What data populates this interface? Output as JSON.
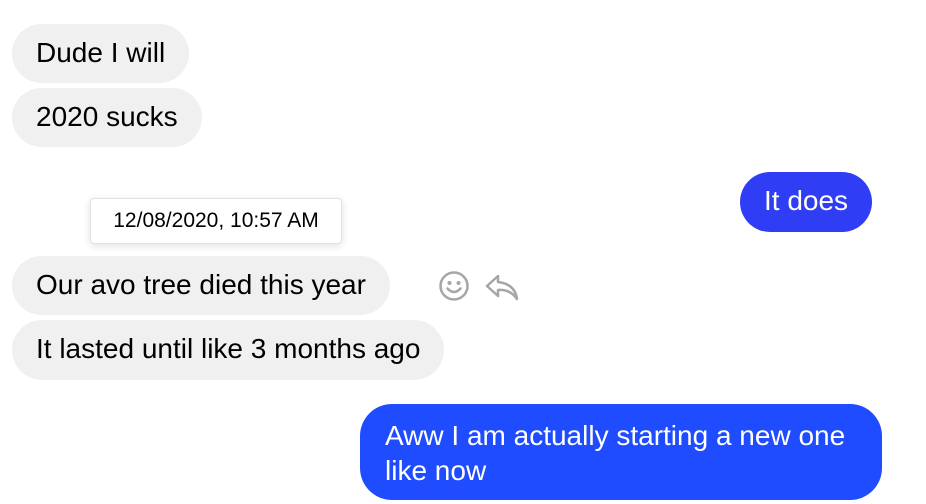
{
  "messages": [
    {
      "sender": "other",
      "text": "Dude I will"
    },
    {
      "sender": "other",
      "text": "2020 sucks"
    },
    {
      "sender": "me",
      "text": "It does"
    },
    {
      "sender": "other",
      "text": "Our avo tree died this year"
    },
    {
      "sender": "other",
      "text": "It lasted until like 3 months ago"
    },
    {
      "sender": "me",
      "text": "Aww I am actually starting a new one like now"
    }
  ],
  "tooltip": {
    "timestamp": "12/08/2020, 10:57 AM"
  },
  "actions": {
    "react_icon": "smiley-icon",
    "reply_icon": "reply-arrow-icon"
  },
  "colors": {
    "incoming_bubble": "#f0f0f0",
    "outgoing_bubble_1": "#2f3df5",
    "outgoing_bubble_2": "#1f4cff",
    "icon": "#a6a6a6"
  }
}
